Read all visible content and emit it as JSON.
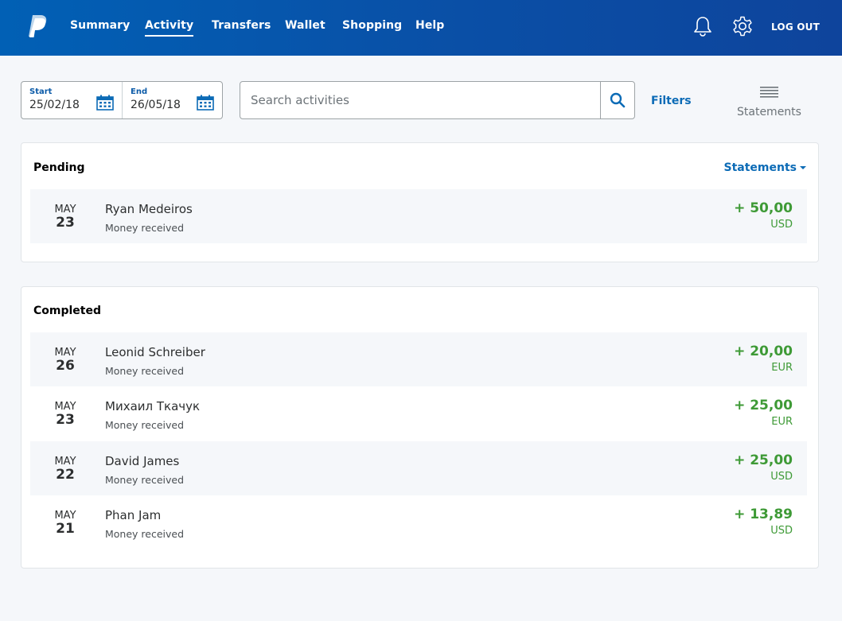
{
  "header": {
    "nav": [
      {
        "label": "Summary",
        "active": false
      },
      {
        "label": "Activity",
        "active": true
      },
      {
        "label": "Transfers",
        "active": false
      },
      {
        "label": "Wallet",
        "active": false
      },
      {
        "label": "Shopping",
        "active": false
      },
      {
        "label": "Help",
        "active": false
      }
    ],
    "logout_label": "LOG OUT",
    "icons": [
      "paypal-logo",
      "bell-icon",
      "gear-icon"
    ]
  },
  "toolbar": {
    "date_start_label": "Start",
    "date_start_value": "25/02/18",
    "date_end_label": "End",
    "date_end_value": "26/05/18",
    "search_placeholder": "Search activities",
    "filters_label": "Filters",
    "statements_label": "Statements"
  },
  "pending": {
    "title": "Pending",
    "statements_dropdown": "Statements",
    "rows": [
      {
        "month": "MAY",
        "day": "23",
        "name": "Ryan Medeiros",
        "desc": "Money received",
        "amount": "+ 50,00",
        "currency": "USD"
      }
    ]
  },
  "completed": {
    "title": "Completed",
    "rows": [
      {
        "month": "MAY",
        "day": "26",
        "name": "Leonid Schreiber",
        "desc": "Money received",
        "amount": "+ 20,00",
        "currency": "EUR"
      },
      {
        "month": "MAY",
        "day": "23",
        "name": "Михаил Ткачук",
        "desc": "Money received",
        "amount": "+ 25,00",
        "currency": "EUR"
      },
      {
        "month": "MAY",
        "day": "22",
        "name": "David James",
        "desc": "Money received",
        "amount": "+ 25,00",
        "currency": "USD"
      },
      {
        "month": "MAY",
        "day": "21",
        "name": "Phan Jam",
        "desc": "Money received",
        "amount": "+ 13,89",
        "currency": "USD"
      }
    ]
  },
  "colors": {
    "brand": "#0160b5",
    "link": "#0c6bb6",
    "positive": "#3e9a36"
  }
}
